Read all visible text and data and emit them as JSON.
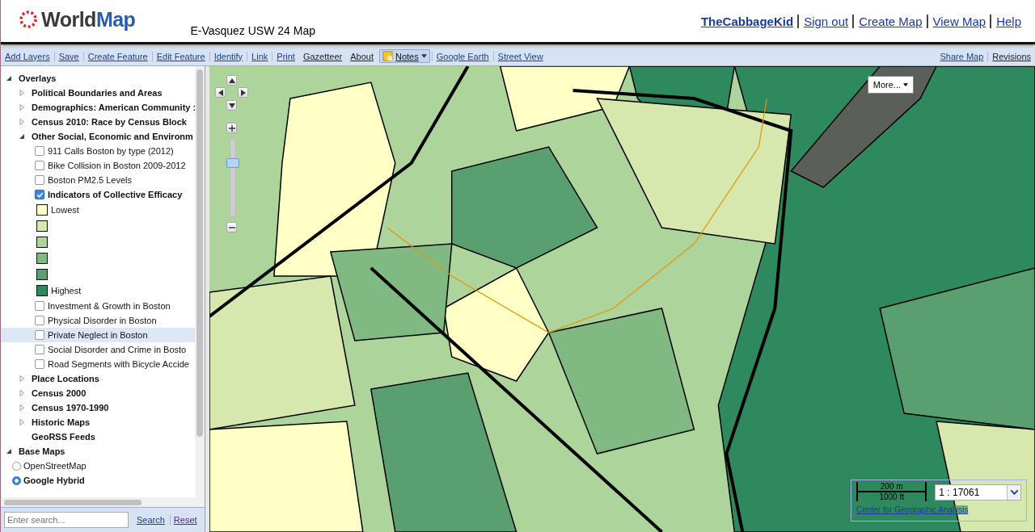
{
  "header": {
    "logo": {
      "first": "World",
      "second": "Map"
    },
    "map_title": "E-Vasquez USW 24 Map",
    "user_links": [
      {
        "label": "TheCabbageKid",
        "kind": "user"
      },
      {
        "label": "Sign out",
        "kind": "link"
      },
      {
        "label": "Create Map",
        "kind": "link"
      },
      {
        "label": "View Map",
        "kind": "link"
      },
      {
        "label": "Help",
        "kind": "link"
      }
    ]
  },
  "toolbar": {
    "left": [
      {
        "label": "Add Layers",
        "kind": "link"
      },
      {
        "label": "Save",
        "kind": "link"
      },
      {
        "label": "Create Feature",
        "kind": "link"
      },
      {
        "label": "Edit Feature",
        "kind": "link"
      },
      {
        "label": "Identify",
        "kind": "link"
      },
      {
        "label": "Link",
        "kind": "link"
      },
      {
        "label": "Print",
        "kind": "link"
      },
      {
        "label": "Gazetteer",
        "kind": "plain"
      },
      {
        "label": "About",
        "kind": "plain"
      },
      {
        "label": "Notes",
        "kind": "menu"
      },
      {
        "label": "Google Earth",
        "kind": "link"
      },
      {
        "label": "Street View",
        "kind": "link"
      }
    ],
    "right": [
      {
        "label": "Share Map",
        "kind": "link"
      },
      {
        "label": "Revisions",
        "kind": "plain"
      }
    ]
  },
  "layer_tree": [
    {
      "label": "Overlays",
      "kind": "root",
      "expanded": true,
      "children": [
        {
          "label": "Political Boundaries and Areas",
          "kind": "folder",
          "expanded": false
        },
        {
          "label": "Demographics: American Community :",
          "kind": "folder",
          "expanded": false
        },
        {
          "label": "Census 2010: Race by Census Block",
          "kind": "folder",
          "expanded": false
        },
        {
          "label": "Other Social, Economic and Environm",
          "kind": "folder",
          "expanded": true,
          "children": [
            {
              "label": "911 Calls Boston by type (2012)",
              "kind": "layer",
              "checked": false,
              "selected": false
            },
            {
              "label": "Bike Collision in Boston 2009-2012",
              "kind": "layer",
              "checked": false,
              "selected": false
            },
            {
              "label": "Boston PM2.5 Levels",
              "kind": "layer",
              "checked": false,
              "selected": false
            },
            {
              "label": "Indicators of Collective Efficacy",
              "kind": "layer",
              "checked": true,
              "selected": false,
              "legend": [
                {
                  "color": "#ffffc6",
                  "label": "Lowest"
                },
                {
                  "color": "#d6e8ad"
                },
                {
                  "color": "#add49b"
                },
                {
                  "color": "#80ba82"
                },
                {
                  "color": "#5a9f70"
                },
                {
                  "color": "#2e8a5e",
                  "label": "Highest"
                }
              ]
            },
            {
              "label": "Investment & Growth in Boston",
              "kind": "layer",
              "checked": false,
              "selected": false
            },
            {
              "label": "Physical Disorder in Boston",
              "kind": "layer",
              "checked": false,
              "selected": false
            },
            {
              "label": "Private Neglect in Boston",
              "kind": "layer",
              "checked": false,
              "selected": true
            },
            {
              "label": "Social Disorder and Crime in Bosto",
              "kind": "layer",
              "checked": false,
              "selected": false
            },
            {
              "label": "Road Segments with Bicycle Accide",
              "kind": "layer",
              "checked": false,
              "selected": false
            }
          ]
        },
        {
          "label": "Place Locations",
          "kind": "folder",
          "expanded": false
        },
        {
          "label": "Census 2000",
          "kind": "folder",
          "expanded": false
        },
        {
          "label": "Census 1970-1990",
          "kind": "folder",
          "expanded": false
        },
        {
          "label": "Historic Maps",
          "kind": "folder",
          "expanded": false
        },
        {
          "label": "GeoRSS Feeds",
          "kind": "feed"
        }
      ]
    },
    {
      "label": "Base Maps",
      "kind": "root",
      "expanded": true,
      "children": [
        {
          "label": "OpenStreetMap",
          "kind": "radio",
          "selected": false
        },
        {
          "label": "Google Hybrid",
          "kind": "radio",
          "selected": true
        }
      ]
    }
  ],
  "search": {
    "placeholder": "Enter search...",
    "buttons": [
      "Search",
      "Reset"
    ]
  },
  "map": {
    "zoom_slider": {
      "level": 0.72
    },
    "more_button": "More...",
    "scale": {
      "metric": "200 m",
      "imperial": "1000 ft",
      "ratio": "1 : 17061"
    },
    "credit": "Center for Geographic Analysis"
  }
}
